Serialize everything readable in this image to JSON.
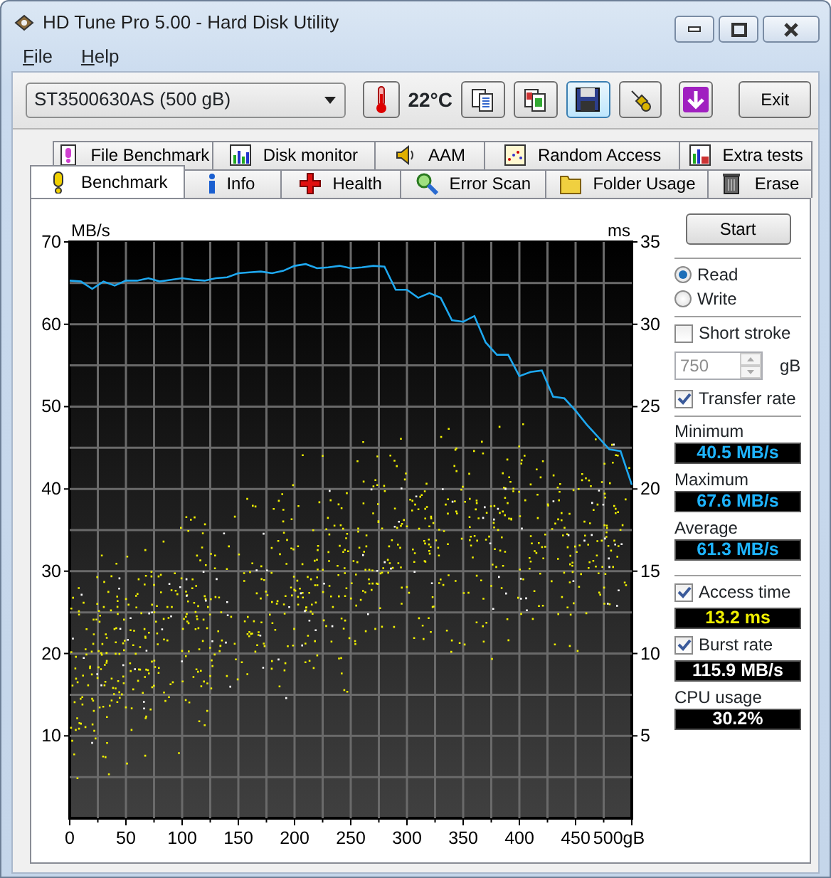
{
  "window": {
    "title": "HD Tune Pro 5.00 - Hard Disk Utility"
  },
  "menu": [
    {
      "label": "File"
    },
    {
      "label": "Help"
    }
  ],
  "toolbar": {
    "drive": "ST3500630AS (500 gB)",
    "temperature": "22°C",
    "buttons": [
      {
        "kind": "copy",
        "selected": false
      },
      {
        "kind": "copy-screen",
        "selected": false
      },
      {
        "kind": "save",
        "selected": true
      },
      {
        "kind": "options",
        "selected": false
      },
      {
        "kind": "download",
        "selected": false
      }
    ],
    "exit": "Exit"
  },
  "tabs_back": [
    {
      "label": "File Benchmark",
      "kind": "file-benchmark",
      "selected": false
    },
    {
      "label": "Disk monitor",
      "kind": "disk-monitor",
      "selected": false
    },
    {
      "label": "AAM",
      "kind": "aam",
      "selected": false
    },
    {
      "label": "Random Access",
      "kind": "random-access",
      "selected": false
    },
    {
      "label": "Extra tests",
      "kind": "extra-tests",
      "selected": false
    }
  ],
  "tabs_front": [
    {
      "label": "Benchmark",
      "kind": "benchmark",
      "selected": true
    },
    {
      "label": "Info",
      "kind": "info",
      "selected": false
    },
    {
      "label": "Health",
      "kind": "health",
      "selected": false
    },
    {
      "label": "Error Scan",
      "kind": "error-scan",
      "selected": false
    },
    {
      "label": "Folder Usage",
      "kind": "folder-usage",
      "selected": false
    },
    {
      "label": "Erase",
      "kind": "erase",
      "selected": false
    }
  ],
  "chart": {
    "chart_data": {
      "type": "line",
      "ylabel": "MB/s",
      "y2label": "ms",
      "xlim": [
        0,
        500
      ],
      "ylim": [
        0,
        70
      ],
      "y2lim": [
        0,
        35
      ],
      "grid": true,
      "xticks": [
        0,
        50,
        100,
        150,
        200,
        250,
        300,
        350,
        400,
        450,
        {
          "value": 500,
          "label": "500gB"
        }
      ],
      "yticks": [
        10,
        20,
        30,
        40,
        50,
        60,
        70
      ],
      "y2ticks": [
        5,
        10,
        15,
        20,
        25,
        30,
        35
      ],
      "x": [
        0,
        10,
        20,
        30,
        40,
        50,
        60,
        70,
        80,
        90,
        100,
        110,
        120,
        130,
        140,
        150,
        160,
        170,
        180,
        190,
        200,
        210,
        220,
        230,
        240,
        250,
        260,
        270,
        280,
        290,
        300,
        310,
        320,
        330,
        340,
        350,
        360,
        370,
        380,
        390,
        400,
        410,
        420,
        430,
        440,
        450,
        460,
        470,
        480,
        490,
        500
      ],
      "series": [
        {
          "color": "#1ea8f0",
          "values": [
            65.3,
            65.2,
            64.3,
            65.2,
            64.7,
            65.3,
            65.3,
            65.6,
            65.2,
            65.4,
            65.6,
            65.4,
            65.3,
            65.6,
            65.7,
            66.2,
            66.3,
            66.4,
            66.2,
            66.5,
            67.1,
            67.3,
            66.8,
            66.9,
            67.1,
            66.8,
            66.9,
            67.1,
            67.0,
            64.2,
            64.2,
            63.2,
            63.8,
            63.2,
            60.5,
            60.3,
            61.0,
            57.8,
            56.3,
            56.3,
            53.7,
            54.2,
            54.4,
            51.2,
            51.0,
            49.5,
            47.8,
            46.3,
            44.8,
            44.6,
            40.5
          ]
        }
      ]
    }
  },
  "sidebar": {
    "start": "Start",
    "mode": [
      {
        "label": "Read",
        "selected": true
      },
      {
        "label": "Write",
        "selected": false
      }
    ],
    "short_stroke": {
      "label": "Short stroke",
      "checked": false
    },
    "stroke_size": {
      "value": "750",
      "unit": "gB",
      "disabled": true
    },
    "transfer_rate": {
      "label": "Transfer rate",
      "checked": true
    },
    "stats": [
      {
        "label": "Minimum",
        "value": "40.5 MB/s"
      },
      {
        "label": "Maximum",
        "value": "67.6 MB/s"
      },
      {
        "label": "Average",
        "value": "61.3 MB/s"
      }
    ],
    "access_time": {
      "label": "Access time",
      "checked": true,
      "value": "13.2 ms"
    },
    "burst_rate": {
      "label": "Burst rate",
      "checked": true,
      "value": "115.9 MB/s"
    },
    "cpu": {
      "label": "CPU usage",
      "value": "30.2%"
    }
  }
}
